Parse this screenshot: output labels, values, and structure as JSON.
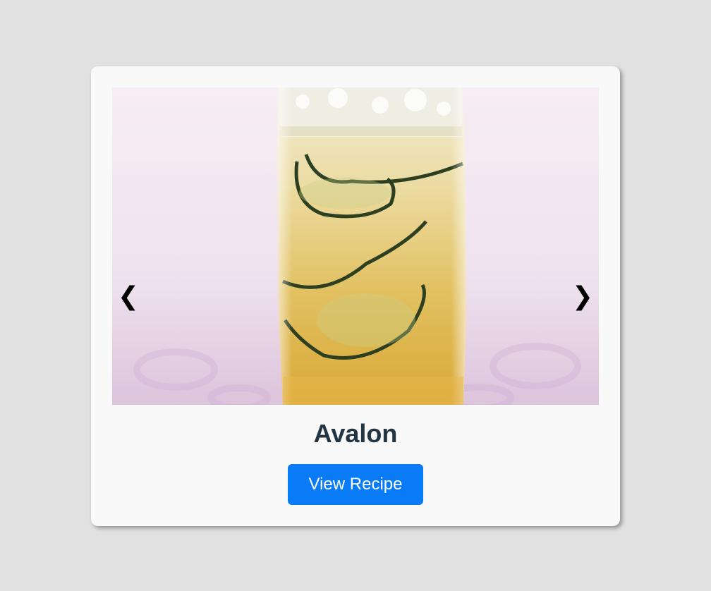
{
  "carousel": {
    "prev_label": "❮",
    "next_label": "❯",
    "image_alt": "Avalon cocktail with cucumber slices in a tall glass"
  },
  "recipe": {
    "title": "Avalon",
    "button_label": "View Recipe"
  },
  "colors": {
    "page_background": "#e1e1e1",
    "card_background": "#f9f9f9",
    "title": "#233443",
    "button": "#0a7bf7",
    "button_text": "#ffffff"
  }
}
